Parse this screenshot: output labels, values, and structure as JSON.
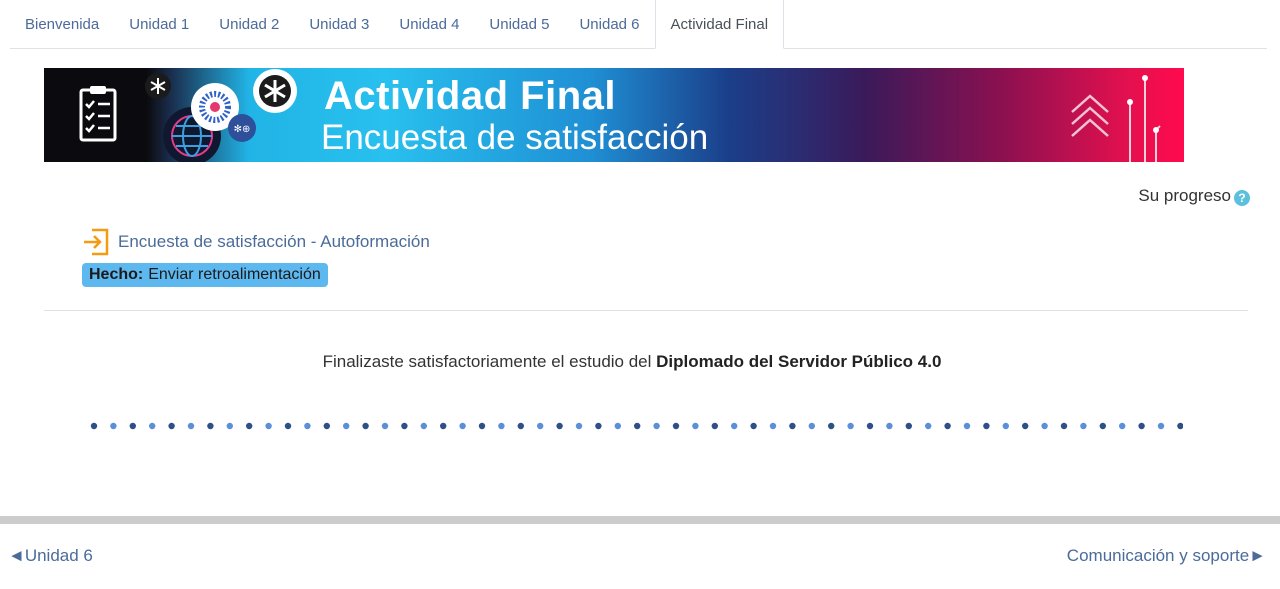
{
  "tabs": [
    {
      "label": "Bienvenida"
    },
    {
      "label": "Unidad 1"
    },
    {
      "label": "Unidad 2"
    },
    {
      "label": "Unidad 3"
    },
    {
      "label": "Unidad 4"
    },
    {
      "label": "Unidad 5"
    },
    {
      "label": "Unidad 6"
    },
    {
      "label": "Actividad Final",
      "active": true
    }
  ],
  "banner": {
    "title": "Actividad Final",
    "subtitle": "Encuesta de satisfacción"
  },
  "progress": {
    "label": "Su progreso",
    "help_icon": "question-circle-icon"
  },
  "activity": {
    "icon": "enter-arrow-icon",
    "name": "Encuesta de satisfacción - Autoformación",
    "completion_status": "Hecho:",
    "completion_requirement": "Enviar retroalimentación"
  },
  "finish": {
    "text_before": "Finalizaste satisfactoriamente el estudio del ",
    "course_name": "Diplomado del Servidor Público 4.0"
  },
  "navigation": {
    "prev_label": "Unidad 6",
    "next_label": "Comunicación y soporte"
  },
  "colors": {
    "link": "#4b6b9a",
    "completion_badge": "#5eb8f0",
    "dot_dark": "#2f4f87",
    "dot_light": "#5b8fd8",
    "activity_icon": "#f39c12"
  }
}
